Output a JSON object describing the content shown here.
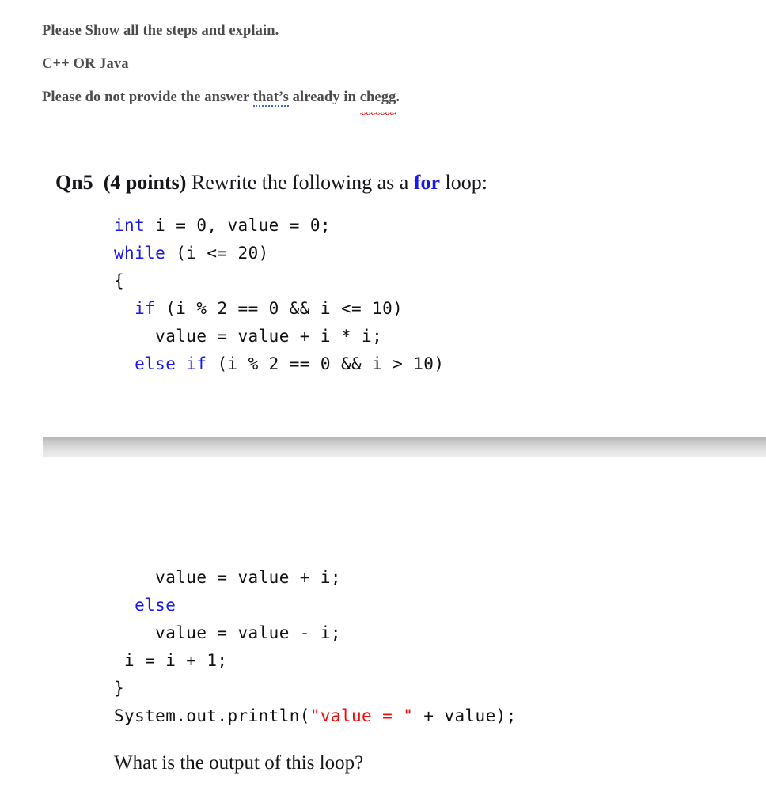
{
  "document": {
    "background_color": "#ffffff",
    "request_text_color": "#4b4b4f",
    "keyword_color": "#1818e8",
    "string_color": "#f40a0a",
    "body_text_color": "#15151a"
  },
  "request": {
    "line1": "Please Show all the steps and explain.",
    "line2": "C++ OR Java",
    "line3_part1": "Please do not provide the answer ",
    "line3_grammar_word": "that’s",
    "line3_part2": " already in ",
    "line3_misspelled_word": "chegg",
    "line3_part3": "."
  },
  "question": {
    "label": "Qn5",
    "points": "(4 points)",
    "prompt_before": "Rewrite the following as a",
    "keyword": "for",
    "prompt_after": "loop:"
  },
  "code_top": {
    "lines": [
      [
        {
          "t": "int",
          "c": "kw"
        },
        {
          "t": " i = 0, value = 0;",
          "c": ""
        }
      ],
      [
        {
          "t": "while",
          "c": "kw"
        },
        {
          "t": " (i <= 20)",
          "c": ""
        }
      ],
      [
        {
          "t": "{",
          "c": ""
        }
      ],
      [
        {
          "t": "  ",
          "c": ""
        },
        {
          "t": "if",
          "c": "kw"
        },
        {
          "t": " (i % 2 == 0 && i <= 10)",
          "c": ""
        }
      ],
      [
        {
          "t": "    value = value + i * i;",
          "c": ""
        }
      ],
      [
        {
          "t": "  ",
          "c": ""
        },
        {
          "t": "else if",
          "c": "kw"
        },
        {
          "t": " (i % 2 == 0 && i > 10)",
          "c": ""
        }
      ]
    ]
  },
  "code_bottom": {
    "lines": [
      [
        {
          "t": "    value = value + i;",
          "c": ""
        }
      ],
      [
        {
          "t": "  ",
          "c": ""
        },
        {
          "t": "else",
          "c": "kw"
        }
      ],
      [
        {
          "t": "    value = value - i;",
          "c": ""
        }
      ],
      [
        {
          "t": " i = i + 1;",
          "c": ""
        }
      ],
      [
        {
          "t": "}",
          "c": ""
        }
      ],
      [
        {
          "t": "System.out.println(",
          "c": ""
        },
        {
          "t": "\"value = \"",
          "c": "str"
        },
        {
          "t": " + value);",
          "c": ""
        }
      ]
    ]
  },
  "closing": {
    "text": "What is the output of this loop?"
  }
}
